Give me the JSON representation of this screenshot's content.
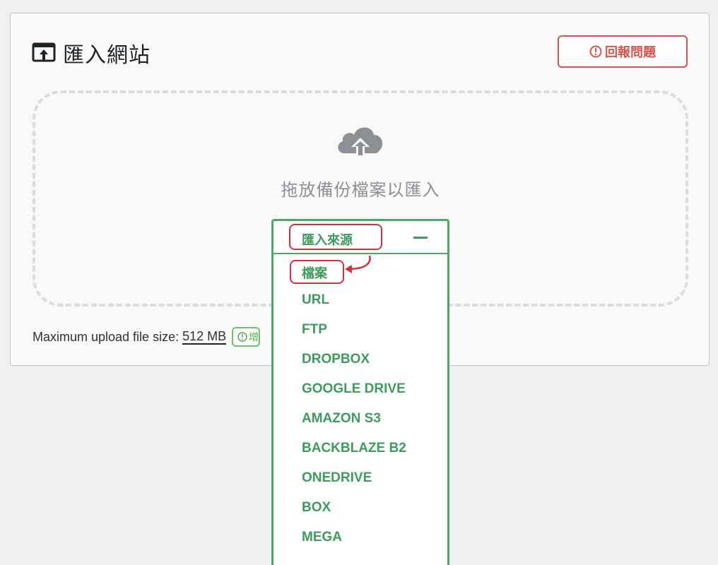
{
  "header": {
    "title": "匯入網站",
    "report_label": "回報問題"
  },
  "dropzone": {
    "text": "拖放備份檔案以匯入"
  },
  "upload": {
    "max_label": "Maximum upload file size:",
    "max_value": "512 MB",
    "increase_label": "增加"
  },
  "import_menu": {
    "label": "匯入來源",
    "items": [
      "檔案",
      "URL",
      "FTP",
      "DROPBOX",
      "GOOGLE DRIVE",
      "AMAZON S3",
      "BACKBLAZE B2",
      "ONEDRIVE",
      "BOX",
      "MEGA"
    ]
  },
  "colors": {
    "accent": "#4ba867",
    "danger": "#d9534f",
    "annotation": "#d0313a"
  }
}
